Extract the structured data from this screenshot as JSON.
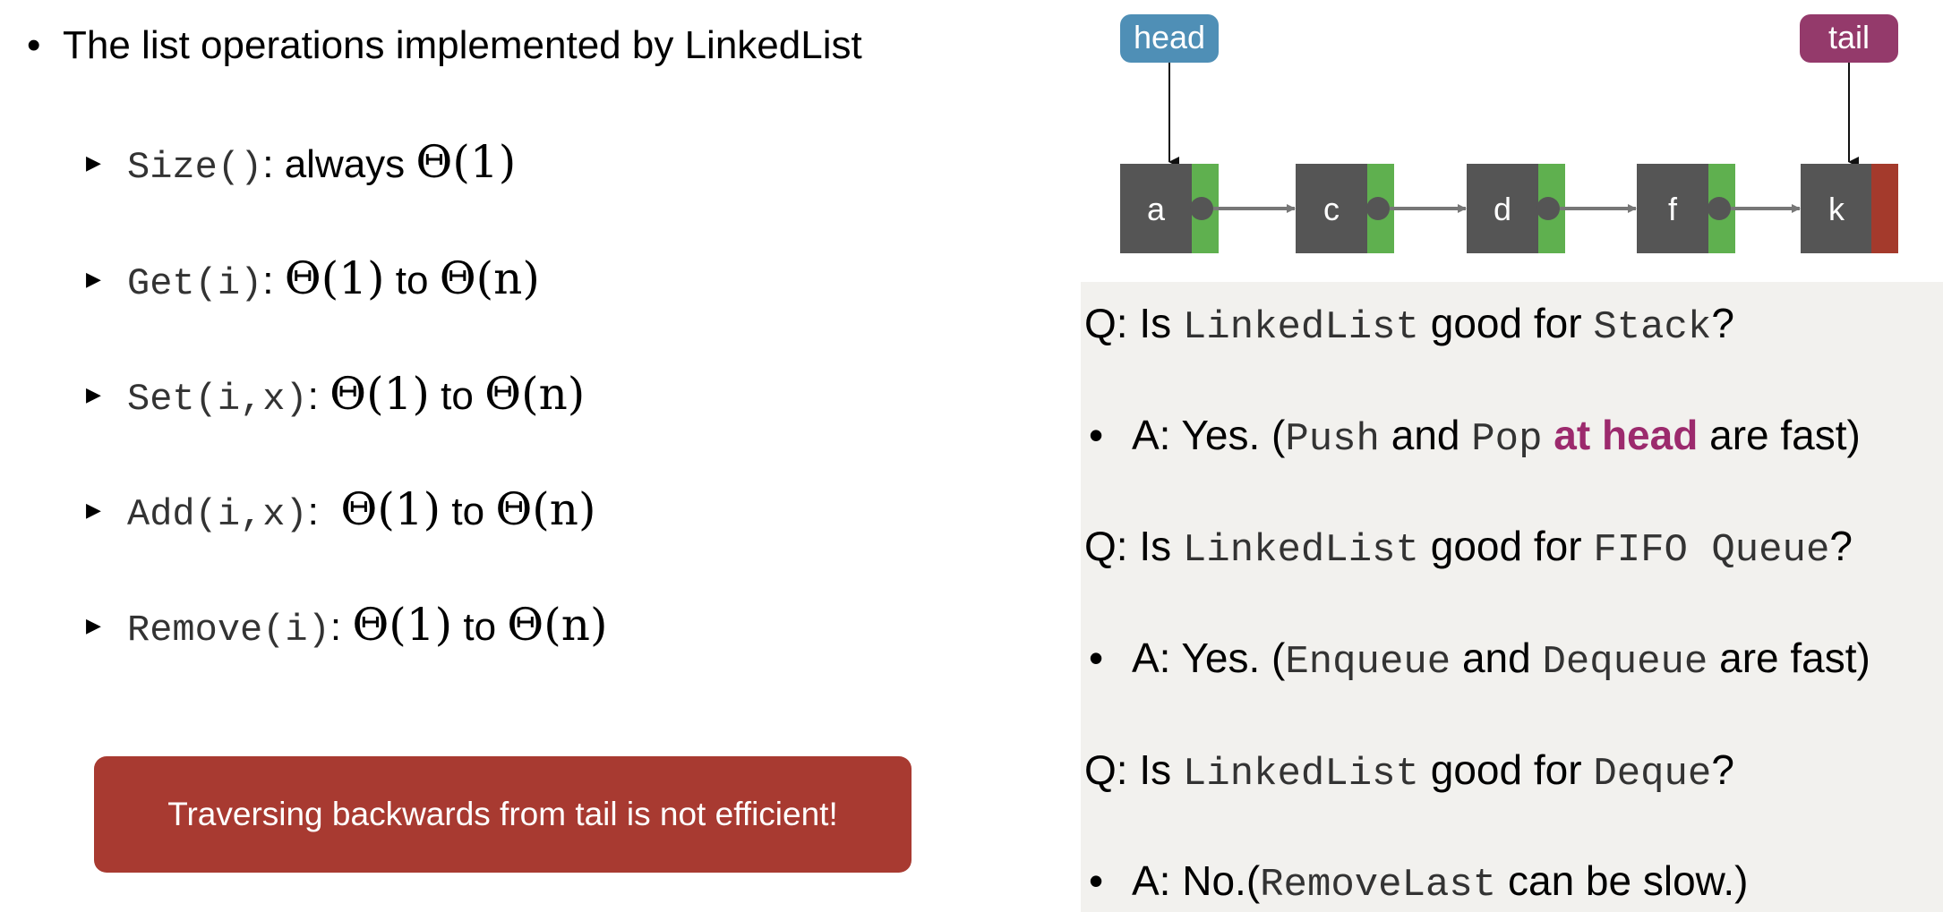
{
  "left": {
    "title": "The list operations implemented by LinkedList",
    "operations": [
      {
        "code": "Size()",
        "sep": ":",
        "text": " always ",
        "from": "Θ(1)",
        "mid": "",
        "to": ""
      },
      {
        "code": "Get(i)",
        "sep": ":",
        "text": " ",
        "from": "Θ(1)",
        "mid": " to ",
        "to": "Θ(n)"
      },
      {
        "code": "Set(i,x)",
        "sep": ":",
        "text": " ",
        "from": "Θ(1)",
        "mid": " to ",
        "to": "Θ(n)"
      },
      {
        "code": "Add(i,x)",
        "sep": ":",
        "text": "  ",
        "from": "Θ(1)",
        "mid": " to ",
        "to": "Θ(n)"
      },
      {
        "code": "Remove(i)",
        "sep": ":",
        "text": " ",
        "from": "Θ(1)",
        "mid": " to ",
        "to": "Θ(n)"
      }
    ],
    "callout": "Traversing backwards from tail is not efficient!"
  },
  "diagram": {
    "head_label": "head",
    "tail_label": "tail",
    "nodes": [
      "a",
      "c",
      "d",
      "f",
      "k"
    ],
    "colors": {
      "head": "#4f8fb6",
      "tail": "#943a6b",
      "node": "#555555",
      "next": "#5fb04f",
      "null": "#a43a2c",
      "arrow": "#777777"
    }
  },
  "qa": [
    {
      "q_pre": "Q: Is ",
      "q_code1": "LinkedList",
      "q_mid": " good for ",
      "q_code2": "Stack",
      "q_post": "?",
      "a_pre": "A: Yes. (",
      "a_code1": "Push",
      "a_mid": " and ",
      "a_code2": "Pop",
      "a_hl": " at head",
      "a_post": " are fast)"
    },
    {
      "q_pre": "Q: Is ",
      "q_code1": "LinkedList",
      "q_mid": " good for ",
      "q_code2": "FIFO Queue",
      "q_post": "?",
      "a_pre": "A: Yes. (",
      "a_code1": "Enqueue",
      "a_mid": " and ",
      "a_code2": "Dequeue",
      "a_hl": "",
      "a_post": " are fast)"
    },
    {
      "q_pre": "Q: Is ",
      "q_code1": "LinkedList",
      "q_mid": " good for ",
      "q_code2": "Deque",
      "q_post": "?",
      "a_pre": "A: No.(",
      "a_code1": "RemoveLast",
      "a_mid": " can be slow.)",
      "a_code2": "",
      "a_hl": "",
      "a_post": ""
    }
  ]
}
